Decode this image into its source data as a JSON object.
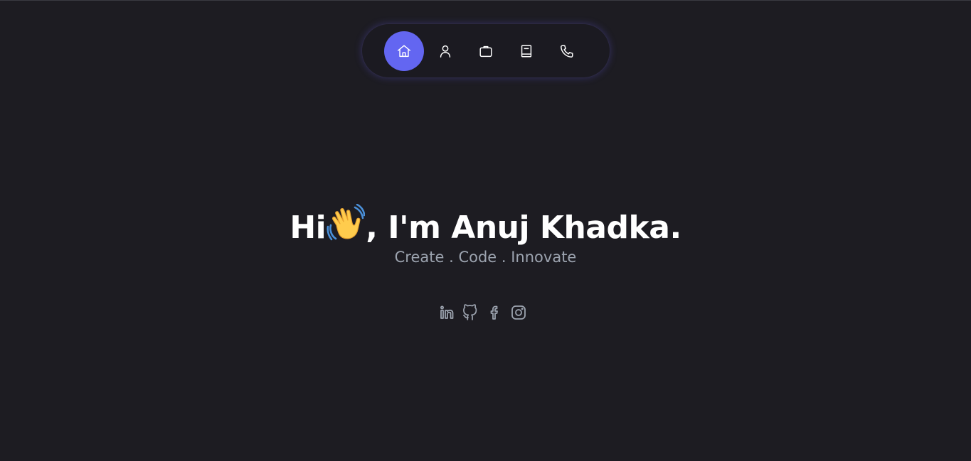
{
  "nav": {
    "items": [
      {
        "icon": "home-icon",
        "active": true
      },
      {
        "icon": "user-icon",
        "active": false
      },
      {
        "icon": "briefcase-icon",
        "active": false
      },
      {
        "icon": "book-icon",
        "active": false
      },
      {
        "icon": "phone-icon",
        "active": false
      }
    ]
  },
  "hero": {
    "greeting": "Hi",
    "emoji": "waving-hand-icon",
    "name_text": ", I'm Anuj Khadka.",
    "tagline": "Create . Code . Innovate"
  },
  "socials": [
    {
      "icon": "linkedin-icon"
    },
    {
      "icon": "github-icon"
    },
    {
      "icon": "facebook-icon"
    },
    {
      "icon": "instagram-icon"
    }
  ],
  "colors": {
    "background": "#1d1c22",
    "accent": "#6366f1",
    "text": "#ffffff",
    "muted": "#9ca3af"
  }
}
